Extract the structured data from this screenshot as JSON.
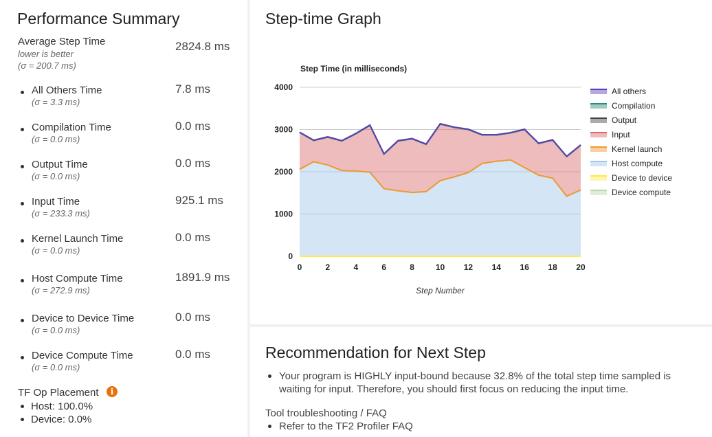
{
  "summary": {
    "title": "Performance Summary",
    "average": {
      "label": "Average Step Time",
      "note": "lower is better",
      "sigma": "(σ = 200.7 ms)",
      "value": "2824.8 ms"
    },
    "metrics": [
      {
        "label": "All Others Time",
        "sigma": "(σ = 3.3 ms)",
        "value": "7.8 ms"
      },
      {
        "label": "Compilation Time",
        "sigma": "(σ = 0.0 ms)",
        "value": "0.0 ms"
      },
      {
        "label": "Output Time",
        "sigma": "(σ = 0.0 ms)",
        "value": "0.0 ms"
      },
      {
        "label": "Input Time",
        "sigma": "(σ = 233.3 ms)",
        "value": "925.1 ms"
      },
      {
        "label": "Kernel Launch Time",
        "sigma": "(σ = 0.0 ms)",
        "value": "0.0 ms"
      },
      {
        "label": "Host Compute Time",
        "sigma": "(σ = 272.9 ms)",
        "value": "1891.9 ms"
      },
      {
        "label": "Device to Device Time",
        "sigma": "(σ = 0.0 ms)",
        "value": "0.0 ms"
      },
      {
        "label": "Device Compute Time",
        "sigma": "(σ = 0.0 ms)",
        "value": "0.0 ms"
      }
    ],
    "placement": {
      "title": "TF Op Placement",
      "info_glyph": "i",
      "host": "Host: 100.0%",
      "device": "Device: 0.0%"
    }
  },
  "graph": {
    "title": "Step-time Graph"
  },
  "recommendation": {
    "title": "Recommendation for Next Step",
    "bullet_line1": "Your program is HIGHLY input-bound because 32.8% of the total step time sampled is",
    "bullet_line2": "waiting for input. Therefore, you should first focus on reducing the input time.",
    "faq_title": "Tool troubleshooting / FAQ",
    "faq_link": "Refer to the TF2 Profiler FAQ"
  },
  "chart_data": {
    "type": "area",
    "title": "Step Time (in milliseconds)",
    "xlabel": "Step Number",
    "ylabel": "",
    "xlim": [
      0,
      20
    ],
    "ylim": [
      0,
      4000
    ],
    "x_ticks": [
      0,
      2,
      4,
      6,
      8,
      10,
      12,
      14,
      16,
      18,
      20
    ],
    "y_ticks": [
      0,
      1000,
      2000,
      3000,
      4000
    ],
    "stacked": true,
    "legend_position": "right",
    "x": [
      0,
      1,
      2,
      3,
      4,
      5,
      6,
      7,
      8,
      9,
      10,
      11,
      12,
      13,
      14,
      15,
      16,
      17,
      18,
      19,
      20
    ],
    "series": [
      {
        "name": "Device compute",
        "color": "#b6d7a8",
        "values": [
          0,
          0,
          0,
          0,
          0,
          0,
          0,
          0,
          0,
          0,
          0,
          0,
          0,
          0,
          0,
          0,
          0,
          0,
          0,
          0,
          0
        ]
      },
      {
        "name": "Device to device",
        "color": "#ffe94d",
        "values": [
          0,
          0,
          0,
          0,
          0,
          0,
          0,
          0,
          0,
          0,
          0,
          0,
          0,
          0,
          0,
          0,
          0,
          0,
          0,
          0,
          0
        ]
      },
      {
        "name": "Host compute",
        "color": "#9fc5e8",
        "values": [
          2060,
          2240,
          2160,
          2030,
          2020,
          1990,
          1600,
          1550,
          1510,
          1530,
          1790,
          1880,
          1980,
          2200,
          2250,
          2280,
          2100,
          1920,
          1850,
          1420,
          1570
        ]
      },
      {
        "name": "Kernel launch",
        "color": "#f29a2e",
        "values": [
          0,
          0,
          0,
          0,
          0,
          0,
          0,
          0,
          0,
          0,
          0,
          0,
          0,
          0,
          0,
          0,
          0,
          0,
          0,
          0,
          0
        ]
      },
      {
        "name": "Input",
        "color": "#d96b6b",
        "values": [
          870,
          500,
          660,
          700,
          880,
          1110,
          820,
          1180,
          1270,
          1120,
          1340,
          1170,
          1020,
          670,
          620,
          640,
          900,
          750,
          900,
          940,
          1060
        ]
      },
      {
        "name": "Output",
        "color": "#444444",
        "values": [
          0,
          0,
          0,
          0,
          0,
          0,
          0,
          0,
          0,
          0,
          0,
          0,
          0,
          0,
          0,
          0,
          0,
          0,
          0,
          0,
          0
        ]
      },
      {
        "name": "Compilation",
        "color": "#2e8b75",
        "values": [
          0,
          0,
          0,
          0,
          0,
          0,
          0,
          0,
          0,
          0,
          0,
          0,
          0,
          0,
          0,
          0,
          0,
          0,
          0,
          0,
          0
        ]
      },
      {
        "name": "All others",
        "color": "#5b3fb5",
        "values": [
          8,
          8,
          8,
          8,
          8,
          8,
          8,
          8,
          8,
          8,
          8,
          8,
          8,
          8,
          8,
          8,
          8,
          8,
          8,
          8,
          8
        ]
      }
    ],
    "legend": [
      "All others",
      "Compilation",
      "Output",
      "Input",
      "Kernel launch",
      "Host compute",
      "Device to device",
      "Device compute"
    ]
  }
}
